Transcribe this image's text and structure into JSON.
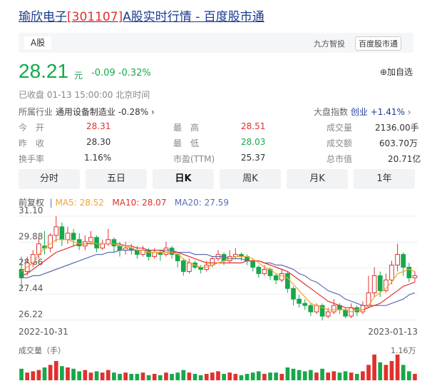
{
  "header": {
    "title_name": "瑜欣电子",
    "title_code": "[301107]",
    "title_rest": "A股实时行情 - 百度股市通"
  },
  "topbar": {
    "tab": "A股",
    "brand1": "九方智投",
    "brand2": "百度股市通"
  },
  "quote": {
    "price": "28.21",
    "unit": "元",
    "change": "-0.09 -0.32%",
    "fav": "⊕加自选",
    "status": "已收盘  01-13 15:00:00  北京时间"
  },
  "industry": {
    "label": "所属行业",
    "name": "通用设备制造业",
    "change": "-0.28%",
    "arrow": "›"
  },
  "market": {
    "label": "大盘指数",
    "name": "创业",
    "change": "+1.41%",
    "arrow": "›"
  },
  "stats": {
    "open_l": "今　开",
    "open_v": "28.31",
    "high_l": "最　高",
    "high_v": "28.51",
    "volume_l": "成交量",
    "volume_v": "2136.00手",
    "prev_l": "昨　收",
    "prev_v": "28.30",
    "low_l": "最　低",
    "low_v": "28.03",
    "amount_l": "成交额",
    "amount_v": "603.70万",
    "turnover_l": "换手率",
    "turnover_v": "1.16%",
    "pe_l": "市盈(TTM)",
    "pe_v": "25.37",
    "mcap_l": "总市值",
    "mcap_v": "20.71亿"
  },
  "tabs": [
    "分时",
    "五日",
    "日K",
    "周K",
    "月K",
    "1年"
  ],
  "active_tab": "日K",
  "legend": {
    "adj": "前复权",
    "ma5": "MA5: 28.52",
    "ma10": "MA10: 28.07",
    "ma20": "MA20: 27.59"
  },
  "colors": {
    "up": "#e0312e",
    "down": "#17a84b",
    "ma5": "#f2a527",
    "ma10": "#e0312e",
    "ma20": "#5b6fb6"
  },
  "chart_data": {
    "type": "candlestick",
    "y_ticks": [
      "31.10",
      "29.88",
      "28.66",
      "27.44",
      "26.22"
    ],
    "ylim": [
      26.22,
      31.1
    ],
    "x_start": "2022-10-31",
    "x_end": "2023-01-13",
    "volume_label": "成交量（手）",
    "volume_max": "1.16万",
    "candles": [
      [
        28.6,
        28.2,
        29.2,
        27.7
      ],
      [
        28.5,
        28.9,
        29.2,
        28.3
      ],
      [
        28.9,
        29.3,
        29.5,
        28.7
      ],
      [
        29.3,
        29.8,
        30.1,
        29.1
      ],
      [
        29.7,
        29.6,
        30.4,
        29.3
      ],
      [
        29.6,
        30.2,
        30.3,
        29.4
      ],
      [
        30.2,
        30.6,
        31.1,
        29.9
      ],
      [
        30.6,
        30.0,
        30.8,
        29.7
      ],
      [
        30.0,
        30.3,
        30.6,
        29.8
      ],
      [
        30.3,
        30.0,
        30.5,
        29.7
      ],
      [
        30.0,
        29.7,
        30.3,
        29.5
      ],
      [
        29.7,
        29.9,
        30.2,
        29.5
      ],
      [
        29.9,
        30.1,
        30.4,
        29.8
      ],
      [
        30.1,
        29.6,
        30.2,
        29.4
      ],
      [
        29.6,
        29.8,
        30.0,
        29.5
      ],
      [
        29.8,
        30.0,
        30.5,
        29.7
      ],
      [
        30.0,
        29.7,
        30.1,
        29.4
      ],
      [
        29.7,
        29.5,
        29.9,
        29.2
      ],
      [
        29.5,
        29.6,
        29.9,
        29.3
      ],
      [
        29.6,
        29.5,
        29.8,
        29.3
      ],
      [
        29.5,
        29.3,
        29.7,
        29.1
      ],
      [
        29.3,
        29.5,
        29.7,
        29.2
      ],
      [
        29.5,
        29.2,
        29.6,
        29.0
      ],
      [
        29.2,
        29.4,
        29.6,
        29.1
      ],
      [
        29.4,
        29.3,
        29.5,
        29.0
      ],
      [
        29.3,
        29.6,
        29.9,
        29.2
      ],
      [
        29.6,
        29.3,
        29.7,
        29.1
      ],
      [
        29.3,
        29.0,
        29.4,
        28.7
      ],
      [
        29.0,
        28.5,
        29.1,
        28.3
      ],
      [
        28.5,
        28.9,
        29.1,
        28.4
      ],
      [
        28.9,
        28.7,
        29.0,
        28.6
      ],
      [
        28.7,
        28.6,
        28.8,
        28.4
      ],
      [
        28.6,
        28.8,
        29.0,
        28.5
      ],
      [
        28.8,
        29.1,
        29.2,
        28.7
      ],
      [
        29.1,
        29.3,
        29.5,
        29.0
      ],
      [
        29.3,
        29.0,
        29.4,
        28.8
      ],
      [
        29.0,
        29.2,
        29.5,
        28.9
      ],
      [
        29.2,
        29.3,
        29.6,
        29.1
      ],
      [
        29.3,
        29.2,
        29.4,
        29.0
      ],
      [
        29.2,
        29.0,
        29.3,
        28.8
      ],
      [
        29.0,
        28.7,
        29.1,
        28.5
      ],
      [
        28.7,
        28.4,
        28.8,
        28.2
      ],
      [
        28.4,
        28.6,
        28.8,
        28.3
      ],
      [
        28.6,
        28.3,
        28.7,
        28.1
      ],
      [
        28.3,
        28.1,
        28.4,
        27.9
      ],
      [
        28.1,
        28.4,
        28.6,
        28.0
      ],
      [
        28.4,
        27.7,
        28.5,
        27.5
      ],
      [
        27.7,
        27.2,
        27.8,
        26.9
      ],
      [
        27.2,
        27.0,
        27.4,
        26.8
      ],
      [
        27.0,
        26.9,
        27.2,
        26.7
      ],
      [
        26.9,
        26.6,
        27.0,
        26.4
      ],
      [
        26.6,
        26.9,
        27.0,
        26.5
      ],
      [
        26.9,
        26.4,
        27.0,
        26.2
      ],
      [
        26.4,
        26.6,
        26.8,
        26.3
      ],
      [
        26.6,
        26.9,
        27.2,
        26.5
      ],
      [
        26.9,
        26.7,
        27.0,
        26.5
      ],
      [
        26.7,
        26.4,
        26.8,
        26.3
      ],
      [
        26.4,
        26.8,
        27.0,
        26.3
      ],
      [
        26.8,
        26.6,
        26.9,
        26.4
      ],
      [
        26.6,
        26.9,
        27.1,
        26.5
      ],
      [
        26.9,
        27.5,
        28.3,
        26.8
      ],
      [
        27.5,
        28.3,
        28.7,
        27.3
      ],
      [
        28.3,
        27.6,
        28.5,
        27.3
      ],
      [
        27.6,
        28.1,
        28.4,
        27.5
      ],
      [
        28.1,
        28.8,
        29.0,
        27.9
      ],
      [
        28.8,
        29.3,
        29.8,
        28.5
      ],
      [
        29.3,
        28.7,
        29.4,
        28.3
      ],
      [
        28.7,
        28.2,
        28.9,
        28.0
      ],
      [
        28.2,
        28.3,
        28.5,
        28.0
      ]
    ],
    "ma5": [
      28.5,
      28.7,
      28.9,
      29.3,
      29.6,
      29.8,
      30.0,
      30.0,
      30.0,
      29.9,
      29.8,
      29.8,
      29.9,
      29.8,
      29.8,
      29.8,
      29.8,
      29.7,
      29.7,
      29.6,
      29.5,
      29.5,
      29.4,
      29.4,
      29.4,
      29.4,
      29.4,
      29.3,
      29.1,
      28.9,
      28.8,
      28.7,
      28.7,
      28.8,
      28.9,
      29.0,
      29.1,
      29.2,
      29.2,
      29.2,
      29.1,
      28.9,
      28.7,
      28.6,
      28.4,
      28.3,
      28.2,
      27.9,
      27.6,
      27.3,
      27.0,
      26.9,
      26.8,
      26.7,
      26.7,
      26.7,
      26.7,
      26.6,
      26.7,
      26.7,
      26.9,
      27.3,
      27.5,
      27.7,
      28.0,
      28.4,
      28.5,
      28.6,
      28.5
    ],
    "ma10": [
      28.3,
      28.4,
      28.6,
      28.8,
      29.0,
      29.2,
      29.4,
      29.5,
      29.6,
      29.7,
      29.8,
      29.8,
      29.8,
      29.8,
      29.8,
      29.8,
      29.8,
      29.8,
      29.7,
      29.7,
      29.6,
      29.6,
      29.5,
      29.5,
      29.5,
      29.4,
      29.4,
      29.4,
      29.3,
      29.2,
      29.1,
      29.0,
      28.9,
      28.9,
      28.9,
      28.9,
      28.9,
      28.9,
      28.9,
      29.0,
      29.0,
      29.0,
      28.9,
      28.8,
      28.7,
      28.6,
      28.5,
      28.3,
      28.1,
      27.9,
      27.7,
      27.5,
      27.3,
      27.1,
      27.0,
      26.9,
      26.8,
      26.8,
      26.7,
      26.7,
      26.8,
      26.9,
      27.0,
      27.2,
      27.4,
      27.6,
      27.8,
      27.9,
      28.0
    ],
    "ma20": [
      28.2,
      28.2,
      28.3,
      28.3,
      28.4,
      28.5,
      28.6,
      28.7,
      28.8,
      28.9,
      29.0,
      29.1,
      29.2,
      29.3,
      29.3,
      29.4,
      29.4,
      29.5,
      29.5,
      29.5,
      29.5,
      29.5,
      29.5,
      29.5,
      29.5,
      29.5,
      29.5,
      29.4,
      29.4,
      29.4,
      29.3,
      29.3,
      29.3,
      29.2,
      29.2,
      29.2,
      29.1,
      29.1,
      29.1,
      29.0,
      29.0,
      29.0,
      28.9,
      28.9,
      28.8,
      28.8,
      28.7,
      28.6,
      28.4,
      28.3,
      28.1,
      28.0,
      27.8,
      27.6,
      27.5,
      27.4,
      27.2,
      27.1,
      27.0,
      26.9,
      26.9,
      26.9,
      26.9,
      26.9,
      27.0,
      27.1,
      27.2,
      27.4,
      27.5
    ],
    "volumes": [
      0.45,
      0.3,
      0.35,
      0.4,
      0.5,
      0.6,
      0.75,
      0.55,
      0.5,
      0.45,
      0.35,
      0.4,
      0.3,
      0.35,
      0.3,
      0.4,
      0.3,
      0.25,
      0.3,
      0.25,
      0.25,
      0.3,
      0.2,
      0.25,
      0.2,
      0.3,
      0.25,
      0.3,
      0.4,
      0.3,
      0.25,
      0.2,
      0.25,
      0.3,
      0.35,
      0.25,
      0.3,
      0.25,
      0.2,
      0.25,
      0.3,
      0.35,
      0.25,
      0.3,
      0.3,
      0.25,
      0.5,
      0.45,
      0.4,
      0.35,
      0.4,
      0.3,
      0.45,
      0.3,
      0.35,
      0.3,
      0.35,
      0.3,
      0.25,
      0.35,
      0.6,
      1.0,
      0.7,
      0.6,
      0.75,
      1.0,
      0.6,
      0.35,
      0.25
    ]
  }
}
